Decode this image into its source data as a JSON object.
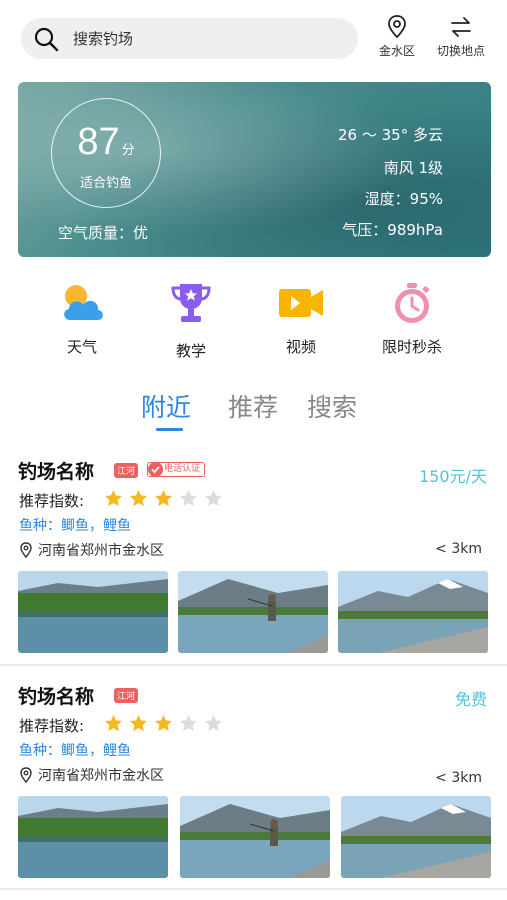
{
  "search": {
    "placeholder": "搜索钓场"
  },
  "location": {
    "label": "金水区"
  },
  "switch": {
    "label": "切换地点"
  },
  "weather": {
    "score": "87",
    "score_unit": "分",
    "score_desc": "适合钓鱼",
    "air_quality": "空气质量：优",
    "temp": "26 ～ 35° 多云",
    "wind": "南风 1级",
    "humidity": "湿度：95%",
    "pressure": "气压：989hPa"
  },
  "quick_menu": [
    {
      "label": "天气",
      "icon": "weather-icon"
    },
    {
      "label": "教学",
      "icon": "trophy-icon"
    },
    {
      "label": "视频",
      "icon": "video-icon"
    },
    {
      "label": "限时秒杀",
      "icon": "timer-icon"
    }
  ],
  "tabs": [
    {
      "label": "附近",
      "active": true
    },
    {
      "label": "推荐",
      "active": false
    },
    {
      "label": "搜索",
      "active": false
    }
  ],
  "listings": [
    {
      "name": "钓场名称",
      "tag": "江河",
      "cert": "电话认证",
      "price": "150元/天",
      "rating_label": "推荐指数:",
      "rating": 3,
      "rating_max": 5,
      "species": "鱼种：鲫鱼，鲤鱼",
      "address": "河南省郑州市金水区",
      "distance": "< 3km"
    },
    {
      "name": "钓场名称",
      "tag": "江河",
      "price": "免费",
      "rating_label": "推荐指数:",
      "rating": 3,
      "rating_max": 5,
      "species": "鱼种：鲫鱼，鲤鱼",
      "address": "河南省郑州市金水区",
      "distance": "< 3km"
    }
  ],
  "colors": {
    "accent": "#2f86e0",
    "price": "#4fc4d8",
    "tag": "#ee5f5f",
    "star": "#f5b81e",
    "star_off": "#dcdcdc"
  }
}
